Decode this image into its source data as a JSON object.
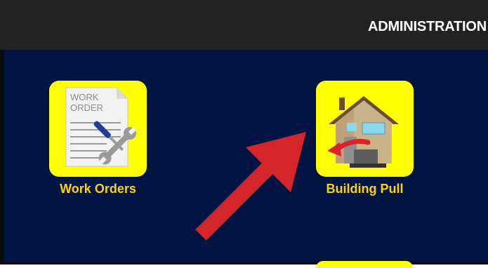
{
  "header": {
    "title": "ADMINISTRATION"
  },
  "tiles": [
    {
      "label": "Work Orders",
      "icon": "work-order-icon",
      "icon_text_line1": "WORK",
      "icon_text_line2": "ORDER"
    },
    {
      "label": "Building Pull",
      "icon": "building-pull-icon"
    }
  ],
  "colors": {
    "topbar": "#222222",
    "background": "#001443",
    "tile": "#ffff00",
    "label": "#ffd200",
    "arrow": "#d4252b"
  }
}
